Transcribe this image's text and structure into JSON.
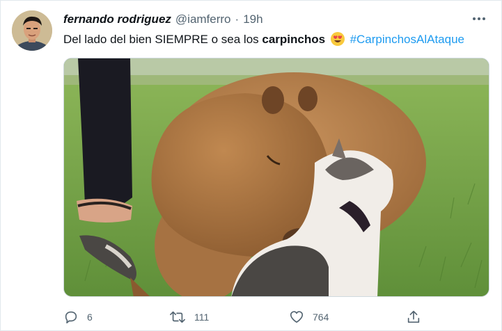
{
  "tweet": {
    "display_name": "fernando rodriguez",
    "handle": "@iamferro",
    "separator": "·",
    "time": "19h",
    "text_plain": "Del lado del bien SIEMPRE o sea los",
    "text_bold": "carpinchos",
    "emoji": "smiling-face-with-heart-eyes",
    "hashtag": "#CarpinchosAlAtaque",
    "media_description_icon": "photo-capybara-and-cat"
  },
  "actions": {
    "reply_count": "6",
    "retweet_count": "111",
    "like_count": "764"
  },
  "colors": {
    "hashtag": "#1d9bf0",
    "muted": "#536471",
    "text": "#0f1419"
  }
}
